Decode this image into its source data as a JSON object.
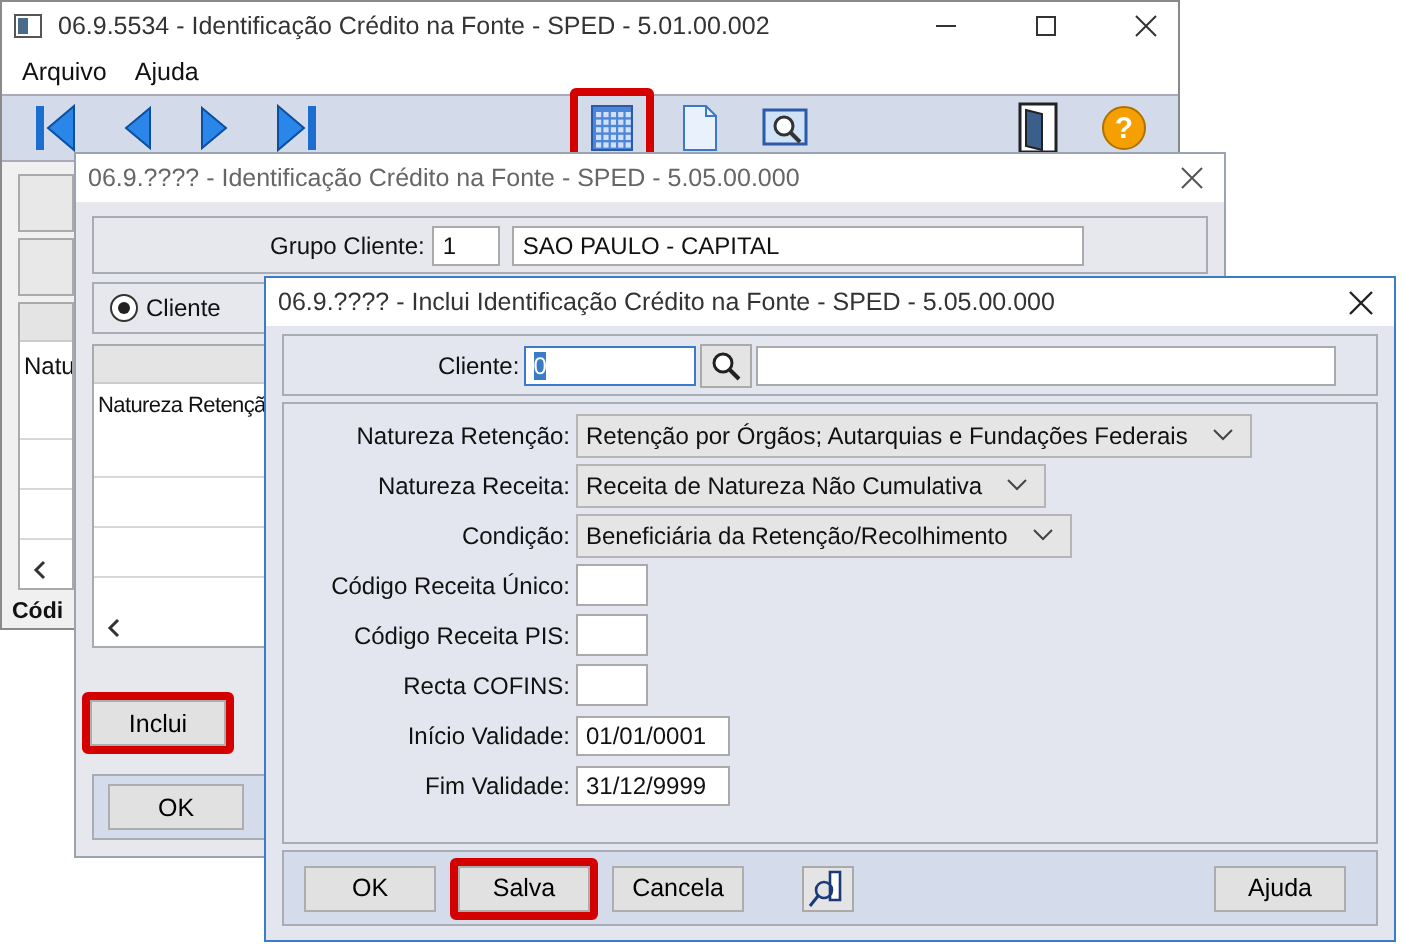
{
  "main_window": {
    "title": "06.9.5534 - Identificação Crédito na Fonte - SPED - 5.01.00.002",
    "menu": [
      {
        "label": "Arquivo"
      },
      {
        "label": "Ajuda"
      }
    ],
    "toolbar": [
      {
        "kind": "first",
        "highlighted": false
      },
      {
        "kind": "prev",
        "highlighted": false
      },
      {
        "kind": "next",
        "highlighted": false
      },
      {
        "kind": "last",
        "highlighted": false
      },
      {
        "kind": "calendar",
        "highlighted": true
      },
      {
        "kind": "document",
        "highlighted": false
      },
      {
        "kind": "preview",
        "highlighted": false
      },
      {
        "kind": "exit",
        "highlighted": false
      },
      {
        "kind": "help",
        "glyph": "?",
        "highlighted": false
      }
    ],
    "grid_cell": "Natu",
    "tab": "Códi"
  },
  "list_window": {
    "title": "06.9.???? - Identificação Crédito na Fonte - SPED - 5.05.00.000",
    "group": {
      "label": "Grupo Cliente:",
      "code": "1",
      "name": "SAO PAULO - CAPITAL"
    },
    "radio": {
      "label": "Cliente",
      "selected": true
    },
    "grid_cell": "Natureza Retençã",
    "buttons": [
      {
        "label": "Inclui",
        "highlighted": true
      }
    ],
    "footer_buttons": [
      {
        "label": "OK"
      }
    ]
  },
  "dialog": {
    "title": "06.9.???? - Inclui Identificação Crédito na Fonte - SPED - 5.05.00.000",
    "client": {
      "label": "Cliente:",
      "value": "0"
    },
    "fields": [
      {
        "kind": "select",
        "label": "Natureza Retenção:",
        "value": "Retenção por Órgãos; Autarquias e Fundações Federais"
      },
      {
        "kind": "select",
        "label": "Natureza Receita:",
        "value": "Receita de Natureza Não Cumulativa"
      },
      {
        "kind": "select",
        "label": "Condição:",
        "value": "Beneficiária da Retenção/Recolhimento"
      },
      {
        "kind": "code",
        "label": "Código Receita Único:"
      },
      {
        "kind": "code",
        "label": "Código Receita PIS:"
      },
      {
        "kind": "code",
        "label": "Recta COFINS:"
      },
      {
        "kind": "date",
        "label": "Início Validade:",
        "value": "01/01/0001"
      },
      {
        "kind": "date",
        "label": "Fim Validade:",
        "value": "31/12/9999"
      }
    ],
    "buttons": [
      {
        "kind": "text",
        "label": "OK",
        "highlighted": false
      },
      {
        "kind": "text",
        "label": "Salva",
        "highlighted": true
      },
      {
        "kind": "text",
        "label": "Cancela",
        "highlighted": false
      },
      {
        "kind": "icon",
        "highlighted": false
      },
      {
        "kind": "spacer"
      },
      {
        "kind": "text",
        "label": "Ajuda",
        "highlighted": false
      }
    ]
  }
}
